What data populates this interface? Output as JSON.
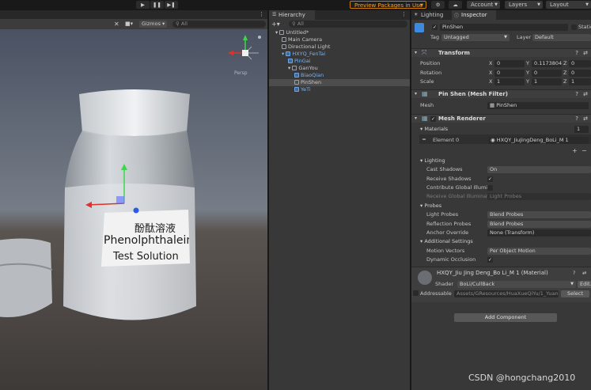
{
  "toolbar": {
    "preview_packages": "Preview Packages in Use",
    "account": "Account",
    "layers": "Layers",
    "layout": "Layout"
  },
  "scene": {
    "gizmos_label": "Gizmos",
    "search_placeholder": "All",
    "view_label": "Persp",
    "label_chinese": "酚酞溶液",
    "label_line1": "Phenolphthalein",
    "label_line2": "Test Solution"
  },
  "hierarchy": {
    "tab": "Hierarchy",
    "search_placeholder": "All",
    "items": [
      {
        "label": "Untitled*",
        "indent": 0,
        "kind": "scene"
      },
      {
        "label": "Main Camera",
        "indent": 1,
        "kind": "object"
      },
      {
        "label": "Directional Light",
        "indent": 1,
        "kind": "object"
      },
      {
        "label": "HXYQ_FenTai",
        "indent": 1,
        "kind": "prefab"
      },
      {
        "label": "PinGai",
        "indent": 2,
        "kind": "prefab"
      },
      {
        "label": "GanYou",
        "indent": 2,
        "kind": "object"
      },
      {
        "label": "BiaoQian",
        "indent": 3,
        "kind": "prefab"
      },
      {
        "label": "PinShen",
        "indent": 3,
        "kind": "object",
        "selected": true
      },
      {
        "label": "YeTi",
        "indent": 3,
        "kind": "prefab"
      }
    ]
  },
  "inspector": {
    "tab_lighting": "Lighting",
    "tab_inspector": "Inspector",
    "object_name": "PinShen",
    "static_label": "Static",
    "tag_label": "Tag",
    "tag_value": "Untagged",
    "layer_label": "Layer",
    "layer_value": "Default",
    "transform": {
      "title": "Transform",
      "position_label": "Position",
      "rotation_label": "Rotation",
      "scale_label": "Scale",
      "position": [
        "0",
        "0.1173804",
        "0"
      ],
      "rotation": [
        "0",
        "0",
        "0"
      ],
      "scale": [
        "1",
        "1",
        "1"
      ],
      "x": "X",
      "y": "Y",
      "z": "Z"
    },
    "mesh_filter": {
      "title": "Pin Shen (Mesh Filter)",
      "mesh_label": "Mesh",
      "mesh_value": "PinShen"
    },
    "mesh_renderer": {
      "title": "Mesh Renderer",
      "materials_label": "Materials",
      "materials_count": "1",
      "element_label": "Element 0",
      "element_value": "HXQY_JiuJingDeng_BoLi_M 1",
      "lighting_label": "Lighting",
      "cast_shadows_label": "Cast Shadows",
      "cast_shadows_value": "On",
      "receive_shadows_label": "Receive Shadows",
      "contribute_gi_label": "Contribute Global Illumin",
      "receive_gi_label": "Receive Global Illuminat",
      "receive_gi_value": "Light Probes",
      "probes_label": "Probes",
      "light_probes_label": "Light Probes",
      "light_probes_value": "Blend Probes",
      "reflection_probes_label": "Reflection Probes",
      "reflection_probes_value": "Blend Probes",
      "anchor_label": "Anchor Override",
      "anchor_value": "None (Transform)",
      "additional_label": "Additional Settings",
      "motion_vectors_label": "Motion Vectors",
      "motion_vectors_value": "Per Object Motion",
      "dynamic_occlusion_label": "Dynamic Occlusion",
      "check": "✓"
    },
    "material": {
      "title": "HXQY_Jiu Jing Deng_Bo Li_M 1 (Material)",
      "shader_label": "Shader",
      "shader_value": "BoLi/CullBack",
      "edit_label": "Edit...",
      "addressable_label": "Addressable",
      "addressable_path": "Assets/GResources/HuaXueQiYu/1_Yuan...",
      "select_label": "Select"
    },
    "add_component": "Add Component"
  },
  "watermark": "CSDN @hongchang2010"
}
